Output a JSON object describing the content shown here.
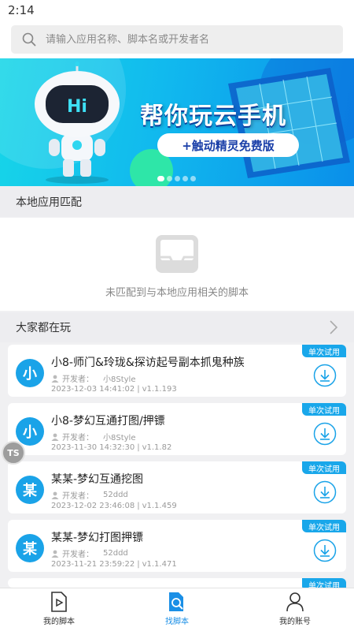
{
  "status_bar": {
    "time": "2:14"
  },
  "search": {
    "placeholder": "请输入应用名称、脚本名或开发者名"
  },
  "banner": {
    "headline": "帮你玩云手机",
    "subline": "+触动精灵免费版",
    "robot_text": "Hi",
    "page_count": 5,
    "active_index": 0
  },
  "local_match": {
    "title": "本地应用匹配",
    "empty_text": "未匹配到与本地应用相关的脚本"
  },
  "popular": {
    "title": "大家都在玩",
    "dev_label": "开发者：",
    "trial_label": "单次试用",
    "items": [
      {
        "avatar": "小",
        "title": "小8-师门&玲珑&探访起号副本抓鬼种族",
        "developer": "小8Style",
        "date": "2023-12-03 14:41:02",
        "version": "v1.1.193"
      },
      {
        "avatar": "小",
        "title": "小8-梦幻互通打图/押镖",
        "developer": "小8Style",
        "date": "2023-11-30 14:32:30",
        "version": "v1.1.82"
      },
      {
        "avatar": "某",
        "title": "某某-梦幻互通挖图",
        "developer": "52ddd",
        "date": "2023-12-02 23:46:08",
        "version": "v1.1.459"
      },
      {
        "avatar": "某",
        "title": "某某-梦幻打图押镖",
        "developer": "52ddd",
        "date": "2023-11-21 23:59:22",
        "version": "v1.1.471"
      }
    ],
    "partial_trial_label": "单次试用"
  },
  "float_ball": {
    "label": "TS"
  },
  "tabbar": {
    "tabs": [
      {
        "label": "我的脚本",
        "icon": "script-file-icon"
      },
      {
        "label": "找脚本",
        "icon": "search-doc-icon"
      },
      {
        "label": "我的账号",
        "icon": "user-icon"
      }
    ],
    "active_index": 1
  },
  "colors": {
    "accent": "#1aa3e8",
    "tab_active": "#1a8fe6",
    "banner_from": "#17d6e8",
    "banner_to": "#0a8fea"
  }
}
